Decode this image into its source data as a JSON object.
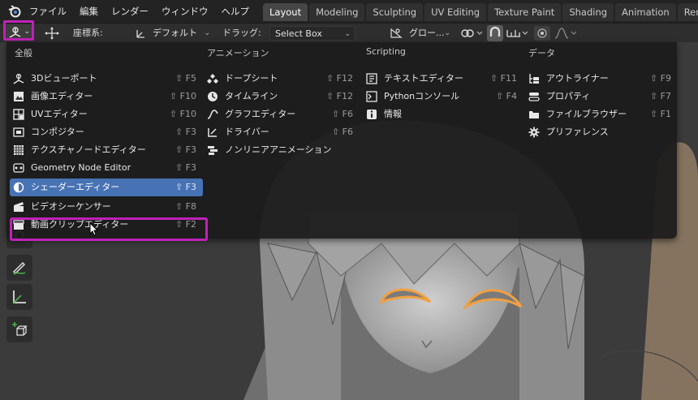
{
  "menubar": {
    "items": [
      "ファイル",
      "編集",
      "レンダー",
      "ウィンドウ",
      "ヘルプ"
    ]
  },
  "workspace_tabs": [
    {
      "label": "Layout",
      "active": true
    },
    {
      "label": "Modeling",
      "active": false
    },
    {
      "label": "Sculpting",
      "active": false
    },
    {
      "label": "UV Editing",
      "active": false
    },
    {
      "label": "Texture Paint",
      "active": false
    },
    {
      "label": "Shading",
      "active": false
    },
    {
      "label": "Animation",
      "active": false
    },
    {
      "label": "Rend",
      "active": false
    }
  ],
  "header": {
    "coord_label": "座標系:",
    "coord_value": "デフォルト",
    "drag_label": "ドラッグ:",
    "drag_value": "Select Box",
    "pivot_value": "グロー..."
  },
  "editor_menu": {
    "columns": [
      {
        "title": "全般",
        "items": [
          {
            "label": "3Dビューポート",
            "shortcut": "⇧ F5",
            "icon": "viewport-3d-icon"
          },
          {
            "label": "画像エディター",
            "shortcut": "⇧ F10",
            "icon": "image-editor-icon"
          },
          {
            "label": "UVエディター",
            "shortcut": "⇧ F10",
            "icon": "uv-editor-icon"
          },
          {
            "label": "コンポジター",
            "shortcut": "⇧ F3",
            "icon": "compositor-icon"
          },
          {
            "label": "テクスチャノードエディター",
            "shortcut": "⇧ F3",
            "icon": "texture-node-icon"
          },
          {
            "label": "Geometry Node Editor",
            "shortcut": "⇧ F3",
            "icon": "geometry-node-icon"
          },
          {
            "label": "シェーダーエディター",
            "shortcut": "⇧ F3",
            "icon": "shader-editor-icon",
            "selected": true
          },
          {
            "label": "ビデオシーケンサー",
            "shortcut": "⇧ F8",
            "icon": "video-sequencer-icon"
          },
          {
            "label": "動画クリップエディター",
            "shortcut": "⇧ F2",
            "icon": "movie-clip-icon"
          }
        ]
      },
      {
        "title": "アニメーション",
        "items": [
          {
            "label": "ドープシート",
            "shortcut": "⇧ F12",
            "icon": "dopesheet-icon"
          },
          {
            "label": "タイムライン",
            "shortcut": "⇧ F12",
            "icon": "timeline-icon"
          },
          {
            "label": "グラフエディター",
            "shortcut": "⇧ F6",
            "icon": "graph-editor-icon"
          },
          {
            "label": "ドライバー",
            "shortcut": "⇧ F6",
            "icon": "driver-icon"
          },
          {
            "label": "ノンリニアアニメーション",
            "shortcut": "",
            "icon": "nla-icon"
          }
        ]
      },
      {
        "title": "Scripting",
        "items": [
          {
            "label": "テキストエディター",
            "shortcut": "⇧ F11",
            "icon": "text-editor-icon"
          },
          {
            "label": "Pythonコンソール",
            "shortcut": "⇧ F4",
            "icon": "python-console-icon"
          },
          {
            "label": "情報",
            "shortcut": "",
            "icon": "info-icon"
          }
        ]
      },
      {
        "title": "データ",
        "items": [
          {
            "label": "アウトライナー",
            "shortcut": "⇧ F9",
            "icon": "outliner-icon"
          },
          {
            "label": "プロパティ",
            "shortcut": "⇧ F7",
            "icon": "properties-icon"
          },
          {
            "label": "ファイルブラウザー",
            "shortcut": "⇧ F1",
            "icon": "file-browser-icon"
          },
          {
            "label": "プリファレンス",
            "shortcut": "",
            "icon": "preferences-icon"
          }
        ]
      }
    ]
  },
  "colors": {
    "highlight": "#c021b8",
    "selection": "#4772b3",
    "eye_outline": "#f0a040"
  }
}
